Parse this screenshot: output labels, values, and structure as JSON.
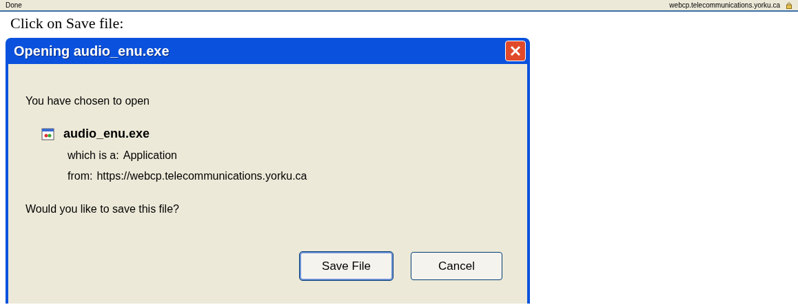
{
  "status_bar": {
    "status": "Done",
    "url": "webcp.telecommunications.yorku.ca"
  },
  "instruction": "Click on Save file:",
  "dialog": {
    "title": "Opening audio_enu.exe",
    "intro": "You have chosen to open",
    "file_name": "audio_enu.exe",
    "details": [
      {
        "label": "which is a:",
        "value": "Application"
      },
      {
        "label": "from:",
        "value": "https://webcp.telecommunications.yorku.ca"
      }
    ],
    "question": "Would you like to save this file?",
    "buttons": [
      {
        "label": "Save File",
        "default": true
      },
      {
        "label": "Cancel",
        "default": false
      }
    ]
  }
}
